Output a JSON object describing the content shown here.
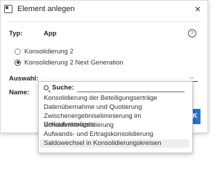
{
  "window": {
    "title": "Element anlegen",
    "close_glyph": "×"
  },
  "form": {
    "typ_label": "Typ:",
    "typ_value": "App",
    "help_glyph": "?",
    "radios": [
      {
        "label": "Konsolidierung 2",
        "checked": false
      },
      {
        "label": "Konsolidierung 2 Next Generation",
        "checked": true
      }
    ],
    "auswahl_label": "Auswahl:",
    "auswahl_chevron": "⌵",
    "name_label": "Name:",
    "ok_label": "K"
  },
  "dropdown": {
    "search_label": "Suche:",
    "search_value": "",
    "options": [
      "Konsolidierung der Beteiligungserträge",
      "Datenübernahme und Quotierung",
      "Zwischenergebniseliminierung im Umlaufvermögen",
      "Schuldenkonsolidierung",
      "Aufwands- und Ertragskonsolidierung",
      "Saldowechsel in Konsolidierungskreisen"
    ],
    "highlighted_index": 5
  },
  "colors": {
    "accent": "#2a72c9",
    "highlight": "#ededed"
  }
}
